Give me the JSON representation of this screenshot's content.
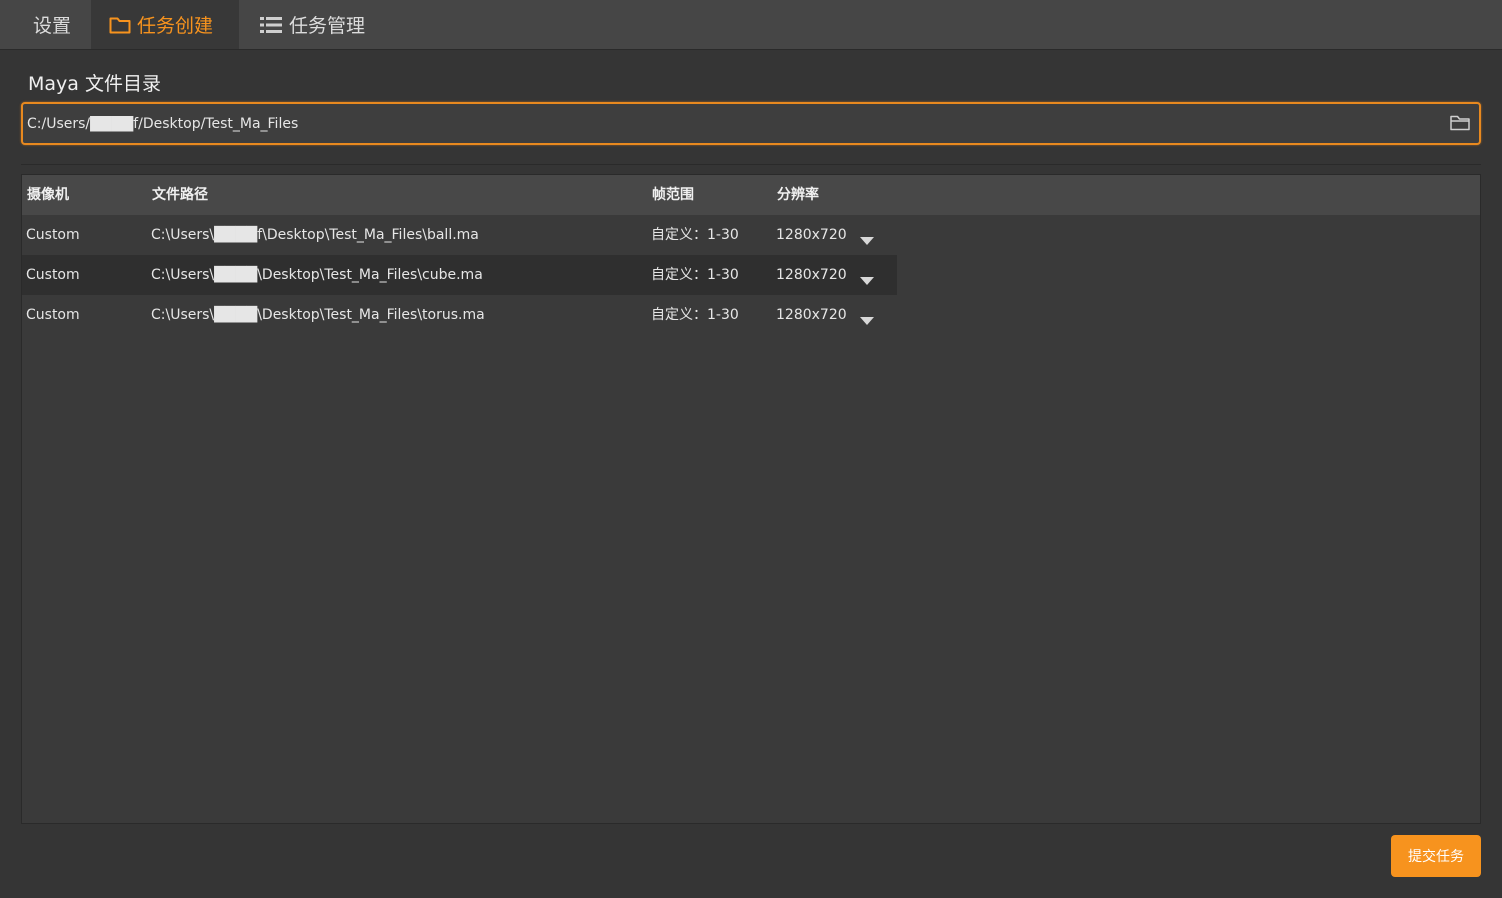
{
  "tabs": [
    {
      "label": "设置",
      "icon": "none",
      "active": false
    },
    {
      "label": "任务创建",
      "icon": "folder-icon",
      "active": true
    },
    {
      "label": "任务管理",
      "icon": "list-icon",
      "active": false
    }
  ],
  "maya_dir": {
    "label": "Maya 文件目录",
    "value": "C:/Users/████f/Desktop/Test_Ma_Files",
    "browse_icon": "folder-icon"
  },
  "table": {
    "headers": [
      "摄像机",
      "文件路径",
      "帧范围",
      "分辨率"
    ],
    "rows": [
      {
        "camera": "Custom",
        "path": "C:\\Users\\████f\\Desktop\\Test_Ma_Files\\ball.ma",
        "range": "自定义：1-30",
        "resolution": "1280x720"
      },
      {
        "camera": "Custom",
        "path": "C:\\Users\\████\\Desktop\\Test_Ma_Files\\cube.ma",
        "range": "自定义：1-30",
        "resolution": "1280x720"
      },
      {
        "camera": "Custom",
        "path": "C:\\Users\\████\\Desktop\\Test_Ma_Files\\torus.ma",
        "range": "自定义：1-30",
        "resolution": "1280x720"
      }
    ]
  },
  "submit_label": "提交任务",
  "colors": {
    "accent": "#f7931e",
    "background": "#353535",
    "tabbar": "#464646"
  }
}
